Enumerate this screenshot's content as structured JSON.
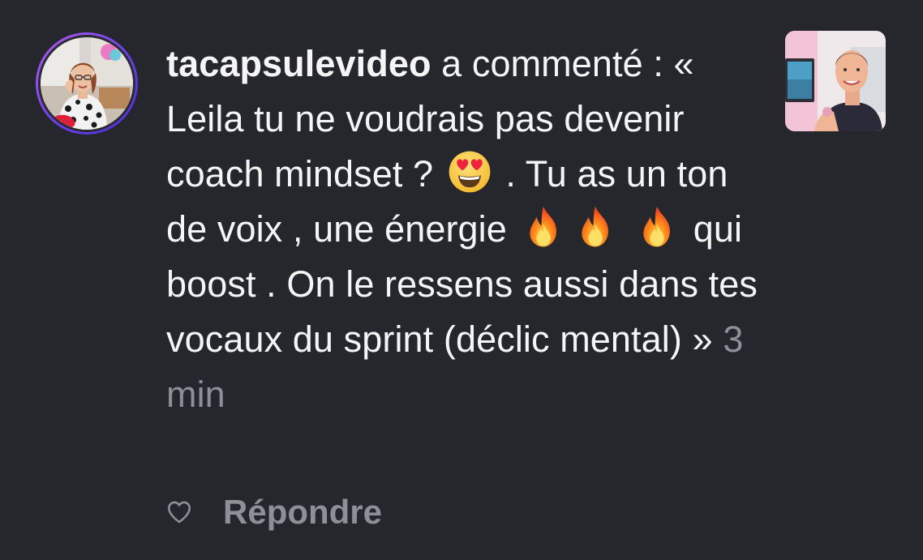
{
  "notification": {
    "username": "tacapsulevideo",
    "action_text": " a commenté : « Leila tu ne voudrais pas devenir coach mindset ?",
    "text_after_emoji": ". Tu as un ton de voix , une énergie",
    "text_after_fire": "qui boost .  On le ressens aussi dans tes vocaux du sprint (déclic mental) »",
    "timestamp": "3 min",
    "emojis": [
      "heart-eyes-emoji",
      "fire-emoji",
      "fire-emoji",
      "fire-emoji"
    ]
  },
  "actions": {
    "like_icon": "heart-outline-icon",
    "reply_label": "Répondre"
  },
  "colors": {
    "background": "#26272d",
    "text": "#f5f5f7",
    "muted": "#8e9097",
    "story_ring": "#6a3ee8"
  }
}
